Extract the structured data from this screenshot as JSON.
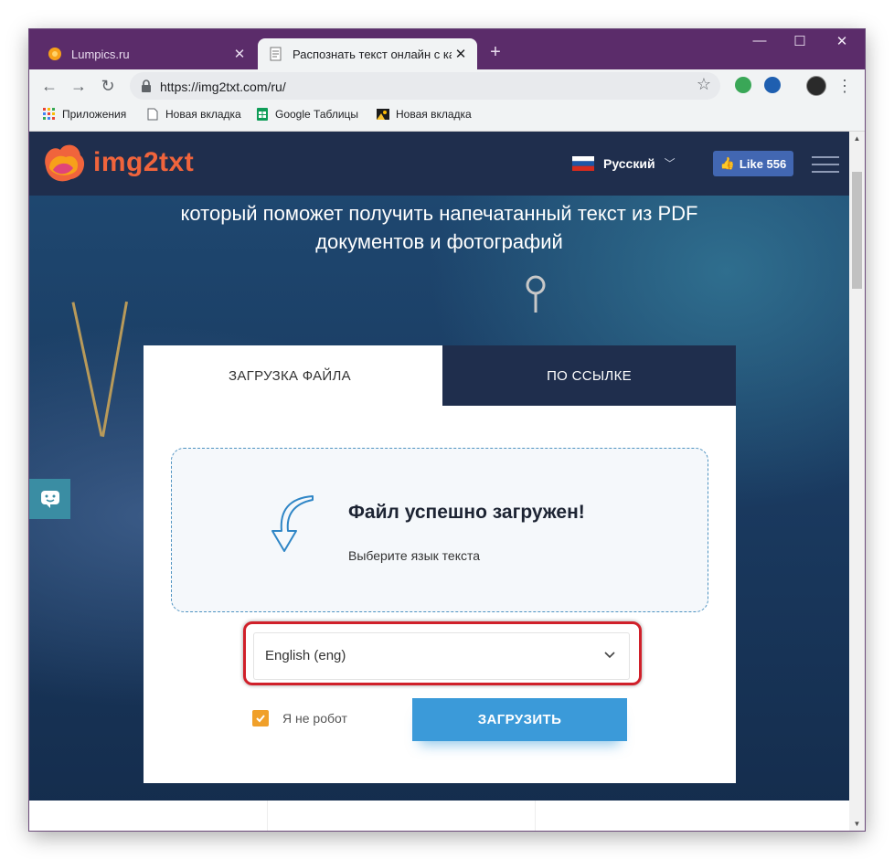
{
  "browser": {
    "tabs": [
      {
        "title": "Lumpics.ru",
        "active": false
      },
      {
        "title": "Распознать текст онлайн с карт",
        "active": true
      }
    ],
    "url": "https://img2txt.com/ru/",
    "bookmarks": [
      "Приложения",
      "Новая вкладка",
      "Google Таблицы",
      "Новая вкладка"
    ]
  },
  "site": {
    "logo_text": "img2txt",
    "language": "Русский",
    "like_label": "Like 556",
    "hero_line1": "который поможет получить напечатанный текст из PDF",
    "hero_line2": "документов и фотографий"
  },
  "upload": {
    "tab_upload": "ЗАГРУЗКА ФАЙЛА",
    "tab_link": "ПО ССЫЛКЕ",
    "success_title": "Файл успешно загружен!",
    "success_sub": "Выберите язык текста",
    "language_value": "English (eng)",
    "captcha_label": "Я не робот",
    "captcha_checked": true,
    "submit_label": "ЗАГРУЗИТЬ"
  },
  "colors": {
    "browser_frame": "#5b2c6a",
    "site_header": "#1f2e4d",
    "logo": "#f0643c",
    "accent_button": "#3b9ad9",
    "checkbox": "#f0a02a",
    "highlight": "#d0202a"
  }
}
